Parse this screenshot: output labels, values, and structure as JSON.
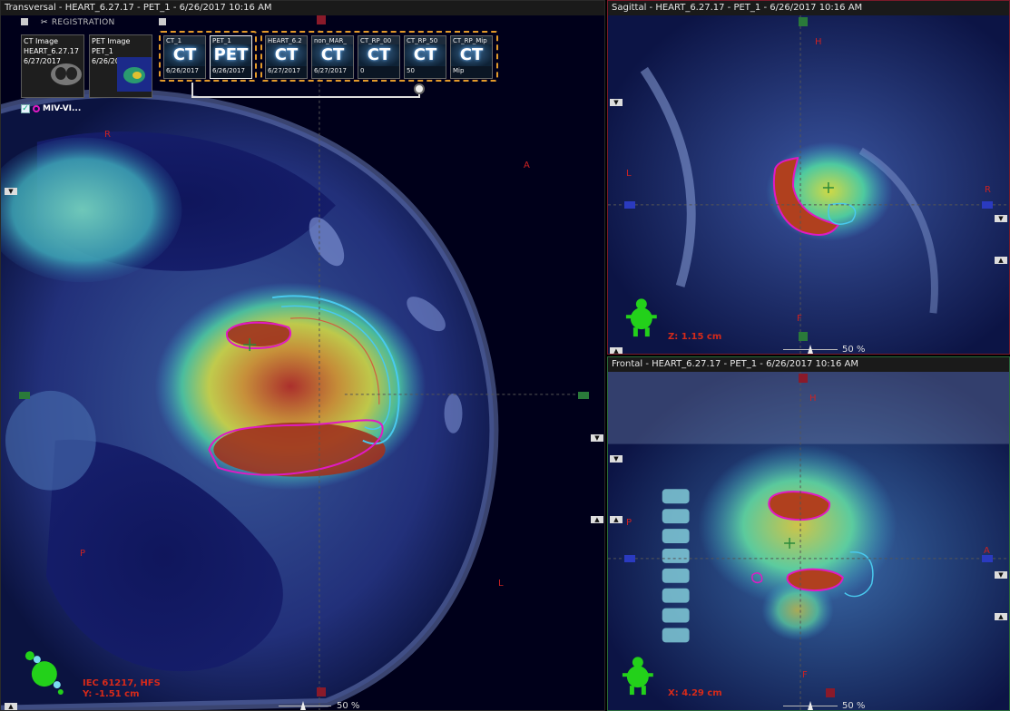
{
  "transversal": {
    "title": "Transversal - HEART_6.27.17 - PET_1 - 6/26/2017 10:16 AM",
    "refresh_icon": "refresh-icon",
    "orient": {
      "top": "R",
      "right": "A",
      "left_bottom": "P",
      "bottom_right": "L"
    },
    "position_info": [
      "IEC 61217, HFS",
      "Y:  -1.51 cm"
    ],
    "zoom": "50 %"
  },
  "sagittal": {
    "title": "Sagittal - HEART_6.27.17 - PET_1 - 6/26/2017 10:16 AM",
    "orient": {
      "top": "H",
      "left": "L",
      "right": "R",
      "bottom": "F"
    },
    "position_info": "Z:  1.15 cm",
    "zoom": "50 %"
  },
  "frontal": {
    "title": "Frontal - HEART_6.27.17 - PET_1 - 6/26/2017 10:16 AM",
    "orient": {
      "top": "H",
      "left": "P",
      "right": "A",
      "bottom": "F"
    },
    "position_info": "X:  4.29 cm",
    "zoom": "50 %"
  },
  "registration": {
    "label": "REGISTRATION",
    "images": [
      {
        "lines": [
          "CT Image",
          "HEART_6.27.17",
          "6/27/2017"
        ]
      },
      {
        "lines": [
          "PET Image",
          "PET_1",
          "6/26/2017"
        ]
      }
    ],
    "group_a": [
      {
        "name": "CT_1",
        "modality": "CT",
        "sub": "6/26/2017",
        "selected": false
      },
      {
        "name": "PET_1",
        "modality": "PET",
        "sub": "6/26/2017",
        "selected": true
      }
    ],
    "group_b": [
      {
        "name": "HEART_6.2",
        "modality": "CT",
        "sub": "6/27/2017"
      },
      {
        "name": "non_MAR_",
        "modality": "CT",
        "sub": "6/27/2017"
      },
      {
        "name": "CT_RP_00",
        "modality": "CT",
        "sub": "0"
      },
      {
        "name": "CT_RP_50",
        "modality": "CT",
        "sub": "50"
      },
      {
        "name": "CT_RP_Mip",
        "modality": "CT",
        "sub": "Mip"
      }
    ],
    "voi_label": "MIV-VI..."
  },
  "colors": {
    "accent_orange": "#e39a2a",
    "contour_magenta": "#e01ac4",
    "contour_cyan": "#49c9ee",
    "crosshair_green": "#2a8a3a",
    "label_red": "#cc2222"
  }
}
